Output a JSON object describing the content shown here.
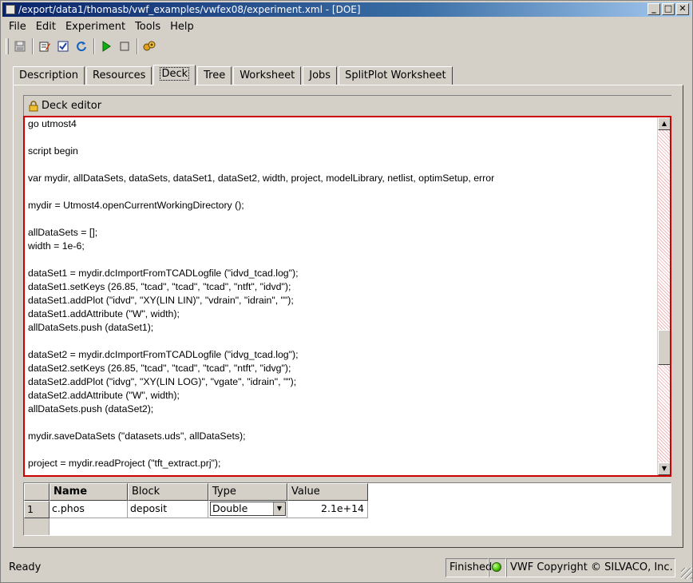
{
  "window": {
    "title": "/export/data1/thomasb/vwf_examples/vwfex08/experiment.xml - [DOE]",
    "minimize": "_",
    "maximize": "□",
    "close": "✕"
  },
  "menu": [
    "File",
    "Edit",
    "Experiment",
    "Tools",
    "Help"
  ],
  "toolbar": {
    "icons": [
      "save-icon",
      "edit-icon",
      "check-icon",
      "refresh-icon",
      "run-icon",
      "stop-icon",
      "plugin-icon"
    ]
  },
  "tabs": [
    "Description",
    "Resources",
    "Deck",
    "Tree",
    "Worksheet",
    "Jobs",
    "SplitPlot Worksheet"
  ],
  "active_tab": "Deck",
  "deck": {
    "label": "Deck editor",
    "lines": [
      "go utmost4",
      "",
      "script begin",
      "",
      "var mydir, allDataSets, dataSets, dataSet1, dataSet2, width, project, modelLibrary, netlist, optimSetup, error",
      "",
      "mydir = Utmost4.openCurrentWorkingDirectory ();",
      "",
      "allDataSets = [];",
      "width = 1e-6;",
      "",
      "dataSet1 = mydir.dcImportFromTCADLogfile (\"idvd_tcad.log\");",
      "dataSet1.setKeys (26.85, \"tcad\", \"tcad\", \"tcad\", \"ntft\", \"idvd\");",
      "dataSet1.addPlot (\"idvd\", \"XY(LIN LIN)\", \"vdrain\", \"idrain\", \"\");",
      "dataSet1.addAttribute (\"W\", width);",
      "allDataSets.push (dataSet1);",
      "",
      "dataSet2 = mydir.dcImportFromTCADLogfile (\"idvg_tcad.log\");",
      "dataSet2.setKeys (26.85, \"tcad\", \"tcad\", \"tcad\", \"ntft\", \"idvg\");",
      "dataSet2.addPlot (\"idvg\", \"XY(LIN LOG)\", \"vgate\", \"idrain\", \"\");",
      "dataSet2.addAttribute (\"W\", width);",
      "allDataSets.push (dataSet2);",
      "",
      "mydir.saveDataSets (\"datasets.uds\", allDataSets);",
      "",
      "project = mydir.readProject (\"tft_extract.prj\");"
    ]
  },
  "params_table": {
    "headers": [
      "Name",
      "Block",
      "Type",
      "Value"
    ],
    "rows": [
      {
        "num": "1",
        "name": "c.phos",
        "block": "deposit",
        "type": "Double",
        "value": "2.1e+14"
      }
    ]
  },
  "status": {
    "text": "Ready",
    "state": "Finished",
    "led_color": "#3fbf00",
    "copyright": "VWF Copyright ©  SILVACO, Inc."
  }
}
